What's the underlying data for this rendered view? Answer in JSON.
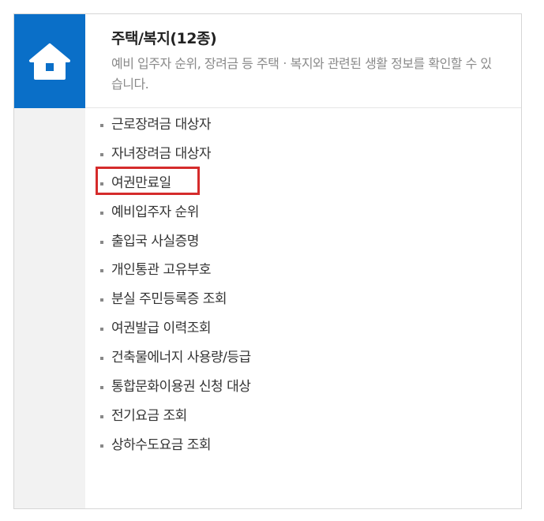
{
  "header": {
    "icon": "home-icon",
    "title": "주택/복지(12종)",
    "description": "예비 입주자 순위, 장려금 등 주택ㆍ복지와 관련된 생활 정보를 확인할 수 있습니다."
  },
  "colors": {
    "accent": "#0a6fc8",
    "highlight": "#d52b2b",
    "sidebar": "#f2f2f2"
  },
  "items": [
    {
      "label": "근로장려금 대상자"
    },
    {
      "label": "자녀장려금 대상자"
    },
    {
      "label": "여권만료일"
    },
    {
      "label": "예비입주자 순위"
    },
    {
      "label": "출입국 사실증명"
    },
    {
      "label": "개인통관 고유부호"
    },
    {
      "label": "분실 주민등록증 조회"
    },
    {
      "label": "여권발급 이력조회"
    },
    {
      "label": "건축물에너지 사용량/등급"
    },
    {
      "label": "통합문화이용권 신청 대상"
    },
    {
      "label": "전기요금 조회"
    },
    {
      "label": "상하수도요금 조회"
    }
  ],
  "highlighted_item": "여권만료일"
}
